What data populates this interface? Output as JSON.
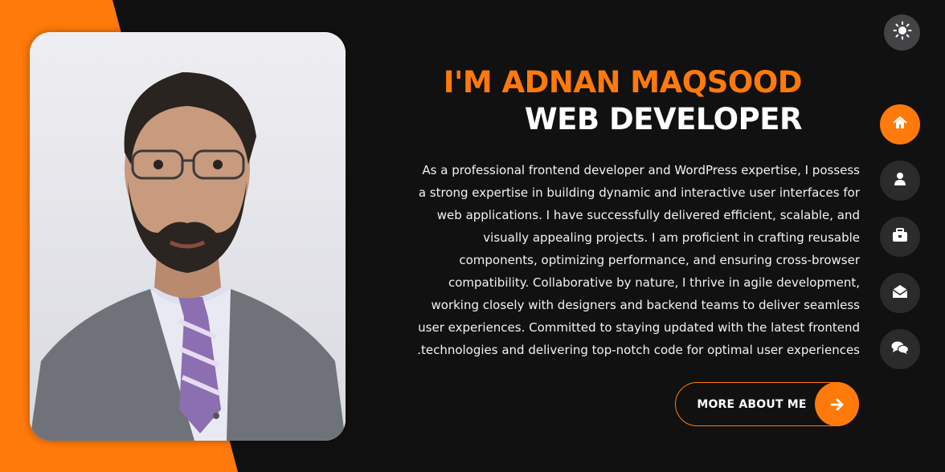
{
  "colors": {
    "accent": "#ff7a0a",
    "background": "#111111",
    "nav_inactive": "#2b2b2b",
    "toggle": "#444446"
  },
  "hero": {
    "greeting": "I'M ADNAN MAQSOOD",
    "role": "WEB DEVELOPER",
    "bio_lines": [
      "As a professional frontend developer and WordPress expertise, I possess",
      "a strong expertise in building dynamic and interactive user interfaces for",
      "web applications. I have successfully delivered efficient, scalable, and",
      "visually appealing projects. I am proficient in crafting reusable",
      "components, optimizing performance, and ensuring cross-browser",
      "compatibility. Collaborative by nature, I thrive in agile development,",
      "working closely with designers and backend teams to deliver seamless",
      "user experiences. Committed to staying updated with the latest frontend",
      ".technologies and delivering top-notch code for optimal user experiences"
    ],
    "cta_label": "MORE ABOUT ME",
    "cta_icon": "arrow-right-icon"
  },
  "theme_toggle": {
    "icon": "sun-icon"
  },
  "nav": [
    {
      "id": "home",
      "icon": "home-icon",
      "active": true
    },
    {
      "id": "about",
      "icon": "user-icon",
      "active": false
    },
    {
      "id": "portfolio",
      "icon": "briefcase-icon",
      "active": false
    },
    {
      "id": "contact",
      "icon": "envelope-open-icon",
      "active": false
    },
    {
      "id": "blog",
      "icon": "comments-icon",
      "active": false
    }
  ]
}
